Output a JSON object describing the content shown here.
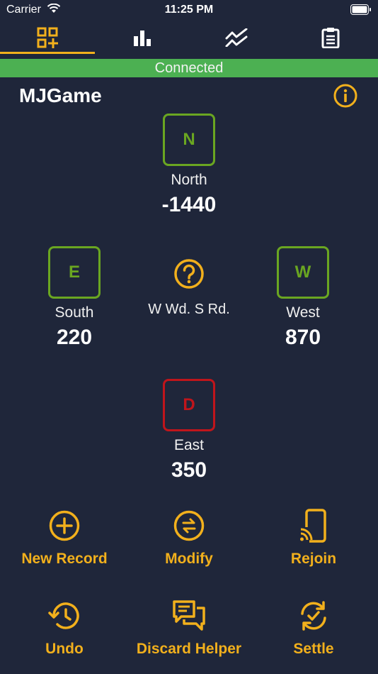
{
  "status_bar": {
    "carrier": "Carrier",
    "time": "11:25 PM"
  },
  "tabs": [
    {
      "name": "record-tab",
      "icon": "qr-add-icon",
      "active": true
    },
    {
      "name": "stats-tab",
      "icon": "bar-chart-icon",
      "active": false
    },
    {
      "name": "trend-tab",
      "icon": "trend-lines-icon",
      "active": false
    },
    {
      "name": "log-tab",
      "icon": "clipboard-icon",
      "active": false
    }
  ],
  "connection": {
    "label": "Connected",
    "color": "#4cb052"
  },
  "game": {
    "title": "MJGame"
  },
  "seats": {
    "north": {
      "tile": "N",
      "name": "North",
      "score": "-1440"
    },
    "south": {
      "tile": "E",
      "name": "South",
      "score": "220"
    },
    "west": {
      "tile": "W",
      "name": "West",
      "score": "870"
    },
    "east": {
      "tile": "D",
      "name": "East",
      "score": "350"
    }
  },
  "center": {
    "wind_text": "W Wd. S Rd."
  },
  "actions": {
    "new_record": "New Record",
    "modify": "Modify",
    "rejoin": "Rejoin",
    "undo": "Undo",
    "discard_helper": "Discard Helper",
    "settle": "Settle"
  },
  "colors": {
    "accent": "#f2b01c",
    "tile_green": "#6aa621",
    "tile_red": "#c0151b",
    "background": "#1f263a"
  }
}
